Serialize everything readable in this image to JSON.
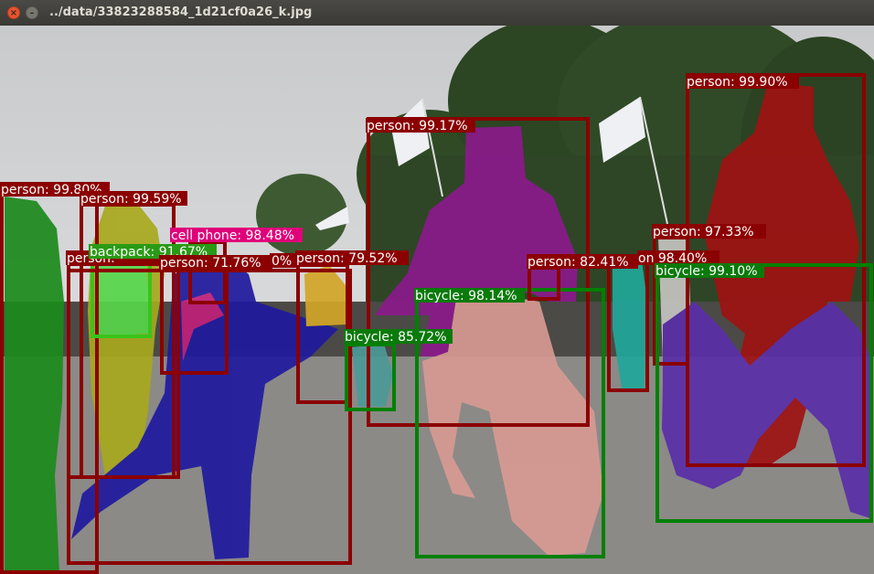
{
  "window": {
    "title": "../data/33823288584_1d21cf0a26_k.jpg",
    "close_glyph": "×",
    "minimize_glyph": "–"
  },
  "colors": {
    "person_box": "#8b0000",
    "bicycle_box": "#008000",
    "backpack_box": "#39c41a",
    "phone_label": "#e0007a"
  },
  "detections": [
    {
      "id": "person-left",
      "label": "person: 99.80%",
      "cls": "person"
    },
    {
      "id": "person-yellow",
      "label": "person: 99.59%",
      "cls": "person"
    },
    {
      "id": "cell-phone",
      "label": "cell phone: 98.48%",
      "cls": "phone"
    },
    {
      "id": "backpack",
      "label": "backpack: 91.67%",
      "cls": "backpack"
    },
    {
      "id": "person-hidden",
      "label": "person: ",
      "cls": "person"
    },
    {
      "id": "person-71",
      "label": "person: 71.76%",
      "cls": "person"
    },
    {
      "id": "person-blue",
      "label": "0%",
      "cls": "person"
    },
    {
      "id": "person-79",
      "label": "person: 79.52%",
      "cls": "person"
    },
    {
      "id": "person-purple",
      "label": "person: 99.17%",
      "cls": "person"
    },
    {
      "id": "bicycle-85",
      "label": "bicycle: 85.72%",
      "cls": "bicycle"
    },
    {
      "id": "bicycle-98",
      "label": "bicycle: 98.14%",
      "cls": "bicycle"
    },
    {
      "id": "person-82",
      "label": "person: 82.41%",
      "cls": "person"
    },
    {
      "id": "person-98",
      "label": "on  98.40%",
      "cls": "person"
    },
    {
      "id": "person-97",
      "label": "person: 97.33%",
      "cls": "person"
    },
    {
      "id": "person-red",
      "label": "person: 99.90%",
      "cls": "person"
    },
    {
      "id": "bicycle-99",
      "label": "bicycle: 99.10%",
      "cls": "bicycle"
    }
  ]
}
